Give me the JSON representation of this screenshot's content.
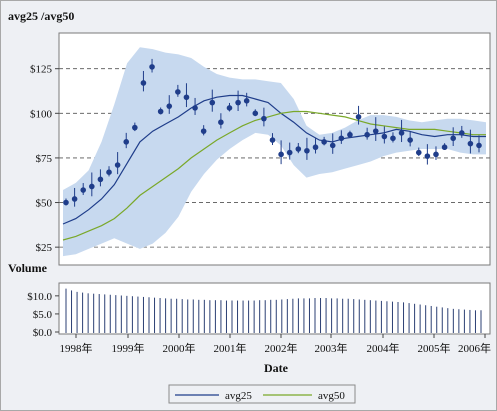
{
  "chart_data": [
    {
      "type": "line",
      "title": "avg25 /avg50",
      "ylabel": "",
      "xlabel": "",
      "ylim": [
        15,
        145
      ],
      "yticks": [
        25,
        50,
        75,
        100,
        125
      ],
      "ytick_labels": [
        "$25",
        "$50",
        "$75",
        "$100",
        "$125"
      ],
      "grid": "horizontal dashed",
      "x": [
        "1997-10",
        "1998-01",
        "1998-04",
        "1998-07",
        "1998-10",
        "1999-01",
        "1999-04",
        "1999-07",
        "1999-10",
        "2000-01",
        "2000-04",
        "2000-07",
        "2000-10",
        "2001-01",
        "2001-04",
        "2001-07",
        "2001-10",
        "2002-01",
        "2002-04",
        "2002-07",
        "2002-10",
        "2003-01",
        "2003-04",
        "2003-07",
        "2003-10",
        "2004-01",
        "2004-04",
        "2004-07",
        "2004-10",
        "2005-01",
        "2005-04",
        "2005-07",
        "2005-10",
        "2006-01"
      ],
      "band": {
        "lower": [
          20,
          21,
          24,
          27,
          30,
          27,
          24,
          27,
          33,
          42,
          56,
          66,
          74,
          80,
          85,
          89,
          88,
          82,
          71,
          64,
          66,
          67,
          69,
          71,
          73,
          76,
          78,
          79,
          80,
          80,
          80,
          78,
          77,
          77
        ],
        "upper": [
          57,
          61,
          68,
          84,
          105,
          128,
          137,
          136,
          134,
          133,
          131,
          126,
          122,
          120,
          119,
          119,
          118,
          117,
          108,
          93,
          88,
          89,
          92,
          96,
          99,
          99,
          98,
          96,
          95,
          96,
          97,
          97,
          96,
          95
        ]
      },
      "series": [
        {
          "name": "avg25",
          "color": "#1f3d8a",
          "values": [
            38,
            41,
            46,
            52,
            60,
            72,
            84,
            90,
            94,
            98,
            103,
            107,
            109,
            110,
            110,
            108,
            106,
            100,
            95,
            89,
            85,
            84,
            86,
            87,
            88,
            89,
            91,
            90,
            88,
            87,
            88,
            88,
            87,
            87
          ]
        },
        {
          "name": "avg50",
          "color": "#7aa829",
          "values": [
            29,
            31,
            34,
            37,
            41,
            47,
            54,
            59,
            64,
            69,
            75,
            80,
            85,
            89,
            93,
            96,
            98,
            100,
            101,
            101,
            100,
            99,
            98,
            96,
            94,
            93,
            92,
            91,
            91,
            91,
            90,
            89,
            88,
            88
          ]
        }
      ],
      "price_points": [
        50,
        52,
        57,
        59,
        63,
        67,
        71,
        84,
        92,
        117,
        126,
        101,
        104,
        112,
        109,
        103,
        90,
        106,
        95,
        103,
        106,
        107,
        100,
        97,
        85,
        77,
        78,
        80,
        79,
        81,
        84,
        82,
        86,
        88,
        98,
        88,
        90,
        87,
        86,
        89,
        85,
        78,
        76,
        77,
        81,
        86,
        89,
        83,
        82
      ]
    },
    {
      "type": "bar",
      "title": "Volume",
      "ylim": [
        0,
        13
      ],
      "yticks": [
        0,
        5,
        10
      ],
      "ytick_labels": [
        "$0.0",
        "$5.0",
        "$10.0"
      ],
      "x_tick_labels": [
        "1998年",
        "1999年",
        "2000年",
        "2001年",
        "2002年",
        "2003年",
        "2004年",
        "2005年",
        "2006年"
      ],
      "xlabel": "Date",
      "values": [
        12,
        11.5,
        11.1,
        10.9,
        10.7,
        10.6,
        10.5,
        10.4,
        10.3,
        10.2,
        10.1,
        10,
        9.9,
        9.8,
        9.7,
        9.6,
        9.5,
        9.4,
        9.3,
        9.2,
        9.2,
        9.1,
        9.0,
        9.0,
        8.9,
        8.9,
        8.8,
        8.8,
        8.8,
        8.7,
        8.7,
        8.7,
        8.7,
        8.7,
        8.7,
        8.8,
        8.8,
        8.9,
        8.9,
        9,
        9.1,
        9.2,
        9.3,
        9.3,
        9.3,
        9.4,
        9.4,
        9.4,
        9.3,
        9.3,
        9.2,
        9.2,
        9.1,
        9.0,
        8.9,
        8.8,
        8.7,
        8.6,
        8.5,
        8.4,
        8.3,
        8.2,
        8.0,
        7.8,
        7.6,
        7.4,
        7.2,
        7.0,
        6.8,
        6.6,
        6.4,
        6.3,
        6.2,
        6.1,
        6.0,
        6.0
      ]
    }
  ],
  "legend": {
    "entries": [
      {
        "label": "avg25",
        "color": "#1f3d8a"
      },
      {
        "label": "avg50",
        "color": "#7aa829"
      }
    ]
  },
  "colors": {
    "band": "#c7d9ef",
    "marker": "#1f3d8a",
    "volume_bar": "#2b3f73",
    "grid": "#555555"
  }
}
